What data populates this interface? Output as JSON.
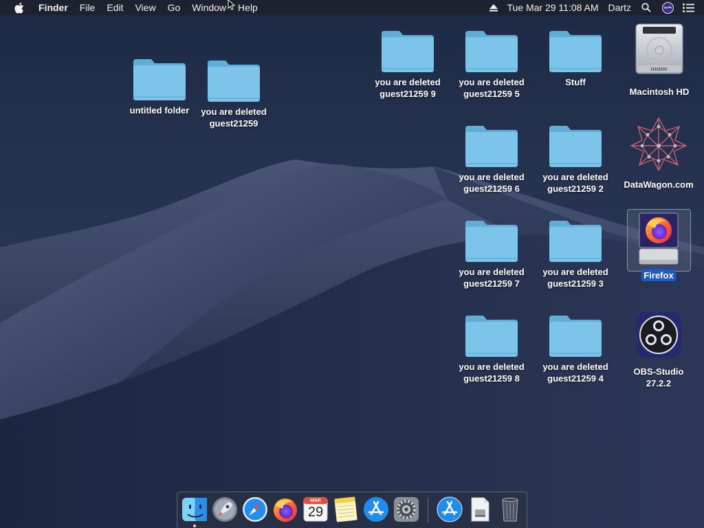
{
  "menubar": {
    "app_name": "Finder",
    "menus": [
      "File",
      "Edit",
      "View",
      "Go",
      "Window",
      "Help"
    ],
    "clock": "Tue Mar 29  11:08 AM",
    "user": "Dartz"
  },
  "desktop": {
    "icons": {
      "untitled_folder": "untitled folder",
      "deleted": "you are deleted\nguest21259",
      "deleted9": "you are deleted\nguest21259 9",
      "deleted5": "you are deleted\nguest21259 5",
      "stuff": "Stuff",
      "macintosh_hd": "Macintosh HD",
      "deleted6": "you are deleted\nguest21259 6",
      "deleted2": "you are deleted\nguest21259 2",
      "datawagon": "DataWagon.com",
      "deleted7": "you are deleted\nguest21259 7",
      "deleted3": "you are deleted\nguest21259 3",
      "firefox": "Firefox",
      "deleted8": "you are deleted\nguest21259 8",
      "deleted4": "you are deleted\nguest21259 4",
      "obs": "OBS-Studio\n27.2.2"
    },
    "selected_icon": "Firefox"
  },
  "dock": {
    "calendar_month": "MAR",
    "calendar_day": "29"
  },
  "colors": {
    "folder": "#7cc4ea",
    "selection": "#1e5bc6",
    "menubar": "#1e222c"
  }
}
